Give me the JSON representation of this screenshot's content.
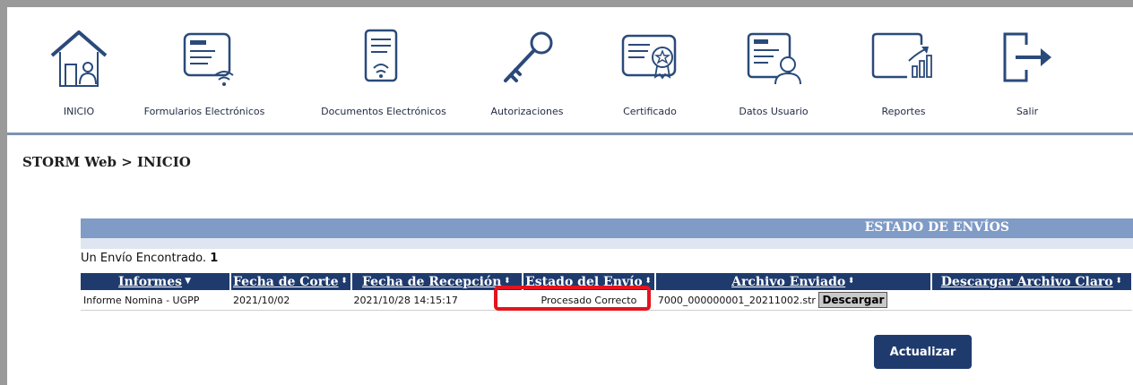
{
  "toolbar": {
    "items": [
      {
        "label": "INICIO",
        "icon": "home-icon"
      },
      {
        "label": "Formularios Electrónicos",
        "icon": "form-wireless-icon"
      },
      {
        "label": "Documentos Electrónicos",
        "icon": "document-wireless-icon"
      },
      {
        "label": "Autorizaciones",
        "icon": "key-icon"
      },
      {
        "label": "Certificado",
        "icon": "certificate-icon"
      },
      {
        "label": "Datos Usuario",
        "icon": "user-card-icon"
      },
      {
        "label": "Reportes",
        "icon": "reports-icon"
      },
      {
        "label": "Salir",
        "icon": "logout-icon"
      }
    ]
  },
  "breadcrumb": "STORM Web > INICIO",
  "panel": {
    "title": "ESTADO DE ENVÍOS",
    "found_text": "Un Envío Encontrado.",
    "found_count": "1"
  },
  "table": {
    "columns": [
      "Informes",
      "Fecha de Corte",
      "Fecha de Recepción",
      "Estado del Envío",
      "Archivo Enviado",
      "Descargar Archivo Claro"
    ],
    "rows": [
      {
        "informe": "Informe Nomina - UGPP",
        "fecha_corte": "2021/10/02",
        "fecha_recepcion": "2021/10/28 14:15:17",
        "estado": "Procesado Correcto",
        "archivo": "7000_000000001_20211002.str",
        "descargar": "Descargar"
      }
    ]
  },
  "actions": {
    "update_label": "Actualizar"
  },
  "colors": {
    "header_blue": "#1f3b6e",
    "panel_blue": "#7f9bc6",
    "highlight_red": "#e3141d",
    "icon_blue": "#2a4a7a"
  }
}
